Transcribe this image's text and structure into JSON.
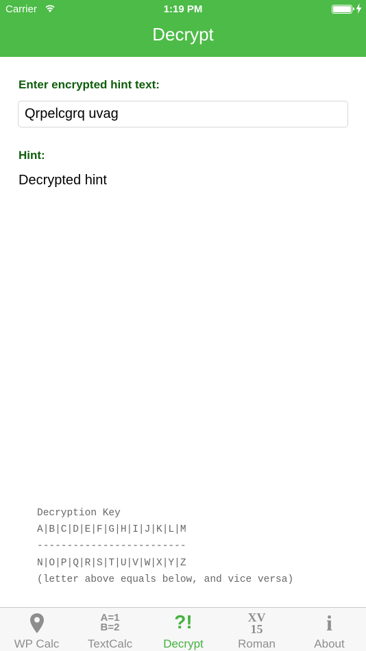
{
  "status_bar": {
    "carrier": "Carrier",
    "time": "1:19 PM"
  },
  "nav": {
    "title": "Decrypt"
  },
  "form": {
    "input_label": "Enter encrypted hint text:",
    "input_value": "Qrpelcgrq uvag",
    "hint_label": "Hint:",
    "hint_value": "Decrypted hint"
  },
  "decryption_key": {
    "title": "Decryption Key",
    "row_top": "A|B|C|D|E|F|G|H|I|J|K|L|M",
    "divider": "-------------------------",
    "row_bottom": "N|O|P|Q|R|S|T|U|V|W|X|Y|Z",
    "note": "(letter above equals below, and vice versa)"
  },
  "tabbar": {
    "tabs": [
      {
        "label": "WP Calc",
        "icon": "map-pin-icon"
      },
      {
        "label": "TextCalc",
        "icon": "a1-b2-icon",
        "icon_lines": [
          "A=1",
          "B=2"
        ]
      },
      {
        "label": "Decrypt",
        "icon": "question-exclamation-icon",
        "icon_text": "?!"
      },
      {
        "label": "Roman",
        "icon": "roman-numeral-icon",
        "icon_lines": [
          "XV",
          "15"
        ]
      },
      {
        "label": "About",
        "icon": "info-icon",
        "icon_text": "i"
      }
    ],
    "active_index": 2
  },
  "colors": {
    "accent": "#4cbb47",
    "label": "#0e5d0b",
    "tab_active": "#45b23f",
    "tab_inactive": "#8e8e8e"
  }
}
